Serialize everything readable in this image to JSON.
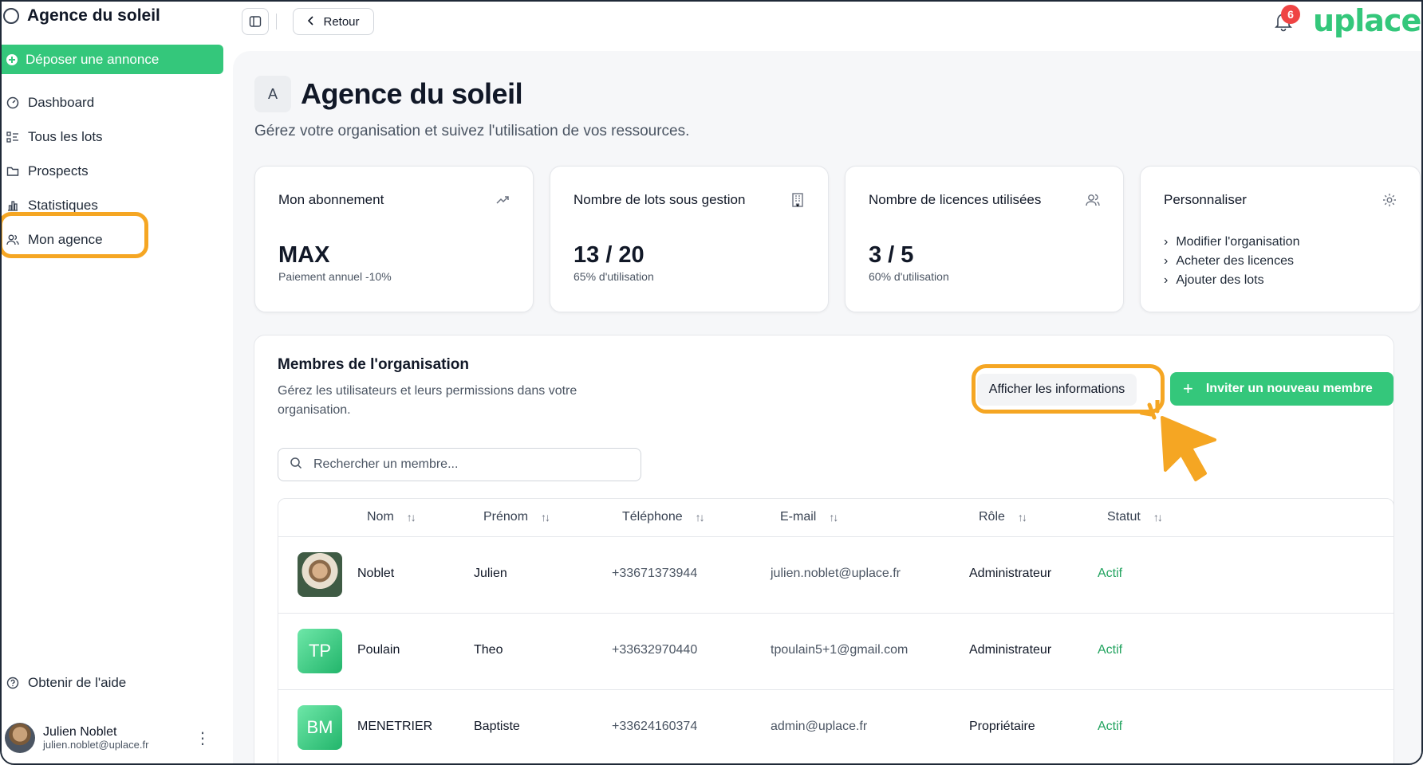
{
  "app": {
    "brand": "Agence du soleil",
    "logo": "uplace"
  },
  "sidebar": {
    "cta": "Déposer une annonce",
    "items": [
      {
        "label": "Dashboard",
        "icon": "gauge-icon"
      },
      {
        "label": "Tous les lots",
        "icon": "list-icon"
      },
      {
        "label": "Prospects",
        "icon": "folder-icon"
      },
      {
        "label": "Statistiques",
        "icon": "bar-chart-icon"
      },
      {
        "label": "Mon agence",
        "icon": "users-icon"
      }
    ],
    "help": "Obtenir de l'aide",
    "user": {
      "name": "Julien Noblet",
      "email": "julien.noblet@uplace.fr"
    }
  },
  "topbar": {
    "back": "Retour",
    "notifications": "6"
  },
  "page": {
    "avatar": "A",
    "title": "Agence du soleil",
    "subtitle": "Gérez votre organisation et suivez l'utilisation de vos ressources."
  },
  "cards": {
    "subscription": {
      "title": "Mon abonnement",
      "value": "MAX",
      "note": "Paiement annuel -10%"
    },
    "lots": {
      "title": "Nombre de lots sous gestion",
      "value": "13 / 20",
      "note": "65% d'utilisation"
    },
    "licences": {
      "title": "Nombre de licences utilisées",
      "value": "3 / 5",
      "note": "60% d'utilisation"
    },
    "customize": {
      "title": "Personnaliser",
      "links": [
        "Modifier l'organisation",
        "Acheter des licences",
        "Ajouter des lots"
      ]
    }
  },
  "members": {
    "title": "Membres de l'organisation",
    "description": "Gérez les utilisateurs et leurs permissions dans votre organisation.",
    "info_button": "Afficher les informations",
    "invite_button": "Inviter un nouveau membre",
    "search_placeholder": "Rechercher un membre...",
    "columns": [
      "Nom",
      "Prénom",
      "Téléphone",
      "E-mail",
      "Rôle",
      "Statut"
    ],
    "rows": [
      {
        "initials": "",
        "nom": "Noblet",
        "prenom": "Julien",
        "tel": "+33671373944",
        "email": "julien.noblet@uplace.fr",
        "role": "Administrateur",
        "statut": "Actif"
      },
      {
        "initials": "TP",
        "nom": "Poulain",
        "prenom": "Theo",
        "tel": "+33632970440",
        "email": "tpoulain5+1@gmail.com",
        "role": "Administrateur",
        "statut": "Actif"
      },
      {
        "initials": "BM",
        "nom": "MENETRIER",
        "prenom": "Baptiste",
        "tel": "+33624160374",
        "email": "admin@uplace.fr",
        "role": "Propriétaire",
        "statut": "Actif"
      }
    ]
  },
  "colors": {
    "accent": "#34c77b",
    "highlight": "#f5a623",
    "status": "#22a35f",
    "badge": "#ef4444"
  }
}
